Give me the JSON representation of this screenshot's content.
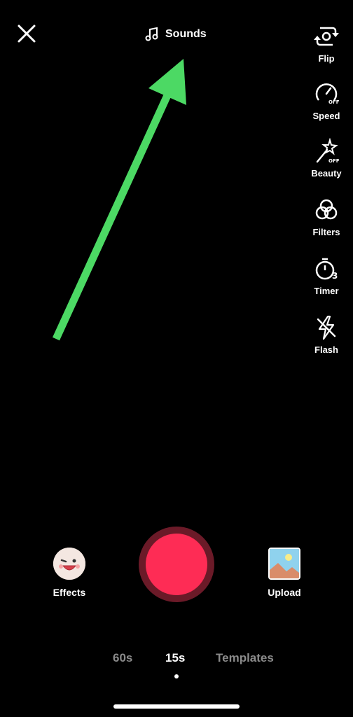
{
  "header": {
    "sounds_label": "Sounds"
  },
  "side_tools": [
    {
      "label": "Flip",
      "icon": "flip-camera-icon"
    },
    {
      "label": "Speed",
      "icon": "speed-off-icon"
    },
    {
      "label": "Beauty",
      "icon": "beauty-off-icon"
    },
    {
      "label": "Filters",
      "icon": "filters-icon"
    },
    {
      "label": "Timer",
      "icon": "timer-icon"
    },
    {
      "label": "Flash",
      "icon": "flash-off-icon"
    }
  ],
  "bottom": {
    "effects_label": "Effects",
    "upload_label": "Upload"
  },
  "modes": [
    {
      "label": "60s",
      "active": false
    },
    {
      "label": "15s",
      "active": true
    },
    {
      "label": "Templates",
      "active": false
    }
  ],
  "icon_text": {
    "off": "OFF",
    "timer_count": "3"
  },
  "colors": {
    "record": "#fe2c55",
    "record_ring": "#6b1a28",
    "arrow": "#4cd964",
    "background": "#000000"
  }
}
